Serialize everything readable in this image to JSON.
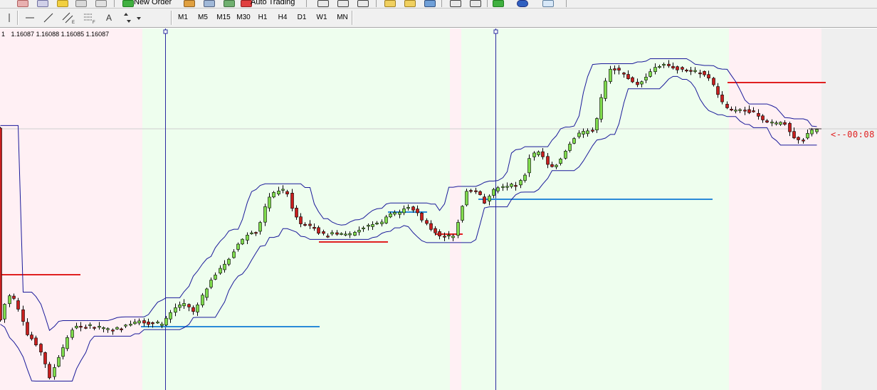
{
  "toolbar": {
    "new_order_label": "New Order",
    "auto_trading_label": "Auto Trading"
  },
  "drawing_tools": {
    "text_tool_label": "A"
  },
  "timeframes": [
    "M1",
    "M5",
    "M15",
    "M30",
    "H1",
    "H4",
    "D1",
    "W1",
    "MN"
  ],
  "chart": {
    "ohlc_readout": "1.16087 1.16088 1.16085 1.16087",
    "symbol_suffix": "1",
    "timer_text": "<--00:08"
  },
  "colors": {
    "bull_candle": "#7fdc4c",
    "bear_candle": "#c81e1e",
    "band_line": "#1a1a9a",
    "zone_pink": "#fff0f4",
    "zone_green": "#eefeee",
    "resistance_line": "#e02020",
    "support_line": "#2a8ad8",
    "session_line": "#2a2aa0"
  }
}
